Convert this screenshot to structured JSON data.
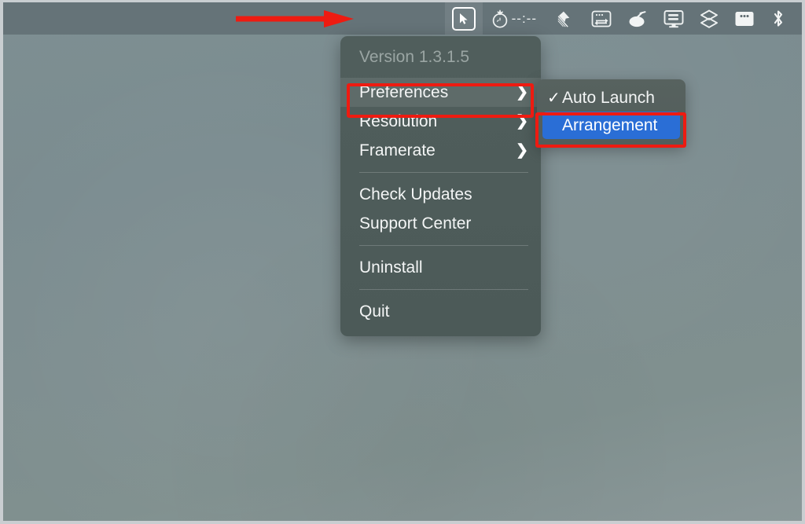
{
  "menubar": {
    "items": [
      {
        "name": "cursor-icon",
        "icon": "cursor-arrow-box",
        "label": "",
        "active": true
      },
      {
        "name": "pomodoro-timer-icon",
        "icon": "tomato-timer",
        "label": "--:--",
        "active": false
      },
      {
        "name": "screenshot-icon",
        "icon": "flag-brush",
        "label": "",
        "active": false
      },
      {
        "name": "window-switch-icon",
        "icon": "window-arrows",
        "label": "",
        "active": false
      },
      {
        "name": "mouse-tool-icon",
        "icon": "mouse-blob",
        "label": "",
        "active": false
      },
      {
        "name": "display-icon",
        "icon": "monitor",
        "label": "",
        "active": false
      },
      {
        "name": "layers-icon",
        "icon": "layers-stack",
        "label": "",
        "active": false
      },
      {
        "name": "window-dots-icon",
        "icon": "window-dots",
        "label": "",
        "active": false
      },
      {
        "name": "bluetooth-icon",
        "icon": "bluetooth",
        "label": "",
        "active": false
      }
    ]
  },
  "menu": {
    "version_label": "Version 1.3.1.5",
    "items": [
      {
        "label": "Preferences",
        "submenu_arrow": "❯",
        "hovered": true
      },
      {
        "label": "Resolution",
        "submenu_arrow": "❯",
        "hovered": false
      },
      {
        "label": "Framerate",
        "submenu_arrow": "❯",
        "hovered": false
      },
      {
        "label": "Check Updates",
        "submenu_arrow": "",
        "hovered": false
      },
      {
        "label": "Support Center",
        "submenu_arrow": "",
        "hovered": false
      },
      {
        "label": "Uninstall",
        "submenu_arrow": "",
        "hovered": false
      },
      {
        "label": "Quit",
        "submenu_arrow": "",
        "hovered": false
      }
    ]
  },
  "submenu": {
    "items": [
      {
        "label": "Auto Launch",
        "checked": true,
        "selected": false,
        "check_glyph": "✓"
      },
      {
        "label": "Arrangement",
        "checked": false,
        "selected": true,
        "check_glyph": "✓"
      }
    ]
  },
  "annotations": {
    "color": "#ee1b11",
    "arrow_name": "red-arrow-pointing-to-cursor-icon",
    "boxes": [
      "preferences-highlight",
      "arrangement-highlight"
    ]
  },
  "colors": {
    "desktop": "#7e8f92",
    "menubar": "#657378",
    "menu_panel": "#4d5b59",
    "submenu_panel": "#545f5d",
    "selection_blue": "#2a6ed6",
    "annotation_red": "#ee1b11",
    "text": "#f3f5f5",
    "text_disabled": "#9aa5a3"
  }
}
